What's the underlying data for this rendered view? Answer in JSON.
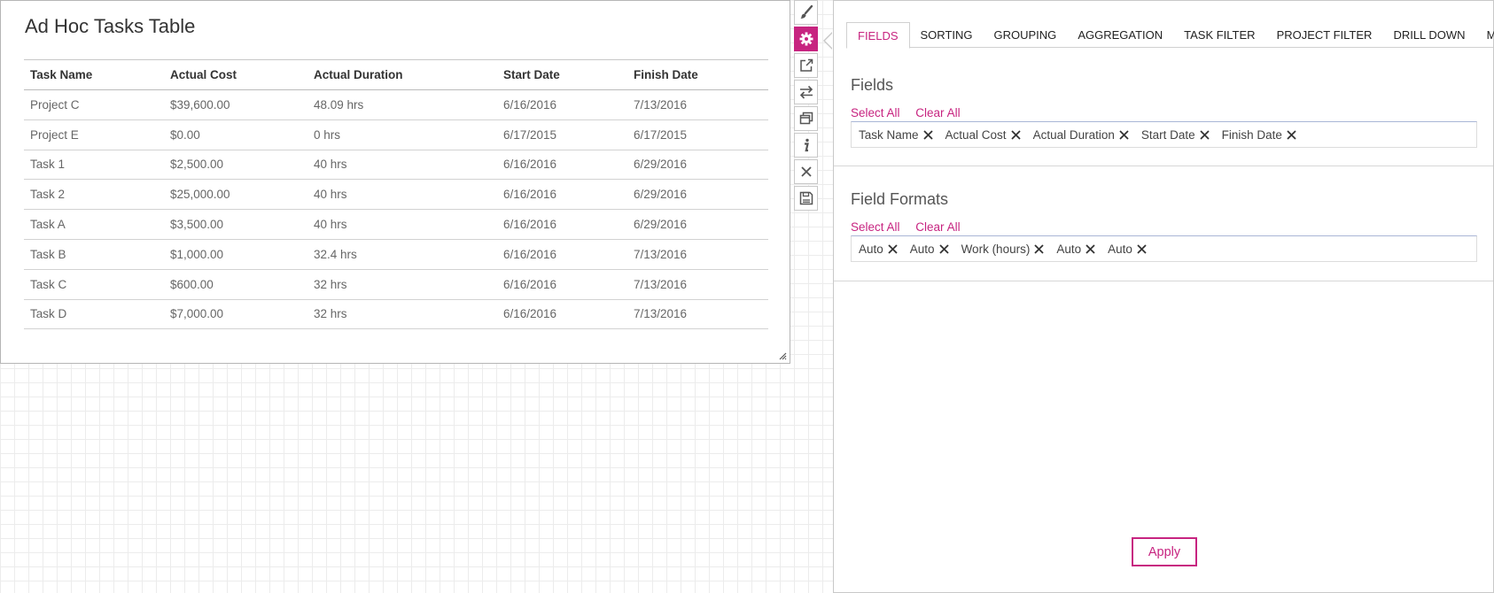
{
  "table_widget": {
    "title": "Ad Hoc Tasks Table",
    "columns": [
      "Task Name",
      "Actual Cost",
      "Actual Duration",
      "Start Date",
      "Finish Date"
    ],
    "rows": [
      [
        "Project C",
        "$39,600.00",
        "48.09 hrs",
        "6/16/2016",
        "7/13/2016"
      ],
      [
        "Project E",
        "$0.00",
        "0 hrs",
        "6/17/2015",
        "6/17/2015"
      ],
      [
        "Task 1",
        "$2,500.00",
        "40 hrs",
        "6/16/2016",
        "6/29/2016"
      ],
      [
        "Task 2",
        "$25,000.00",
        "40 hrs",
        "6/16/2016",
        "6/29/2016"
      ],
      [
        "Task A",
        "$3,500.00",
        "40 hrs",
        "6/16/2016",
        "6/29/2016"
      ],
      [
        "Task B",
        "$1,000.00",
        "32.4 hrs",
        "6/16/2016",
        "7/13/2016"
      ],
      [
        "Task C",
        "$600.00",
        "32 hrs",
        "6/16/2016",
        "7/13/2016"
      ],
      [
        "Task D",
        "$7,000.00",
        "32 hrs",
        "6/16/2016",
        "7/13/2016"
      ]
    ]
  },
  "toolbar": {
    "buttons": [
      "brush-icon",
      "gear-icon",
      "external-link-icon",
      "swap-arrows-icon",
      "copy-window-icon",
      "info-icon",
      "close-icon",
      "save-icon"
    ],
    "active": "gear-icon"
  },
  "settings_panel": {
    "tabs": [
      {
        "label": "FIELDS",
        "active": true
      },
      {
        "label": "SORTING"
      },
      {
        "label": "GROUPING"
      },
      {
        "label": "AGGREGATION"
      },
      {
        "label": "TASK FILTER"
      },
      {
        "label": "PROJECT FILTER"
      },
      {
        "label": "DRILL DOWN"
      },
      {
        "label": "MISC"
      }
    ],
    "fields_section": {
      "title": "Fields",
      "select_all": "Select All",
      "clear_all": "Clear All",
      "chips": [
        "Task Name",
        "Actual Cost",
        "Actual Duration",
        "Start Date",
        "Finish Date"
      ]
    },
    "formats_section": {
      "title": "Field Formats",
      "select_all": "Select All",
      "clear_all": "Clear All",
      "chips": [
        "Auto",
        "Auto",
        "Work (hours)",
        "Auto",
        "Auto"
      ]
    },
    "apply_label": "Apply"
  },
  "colors": {
    "accent": "#c72480",
    "border": "#c8c8c8",
    "grid": "#ececec"
  }
}
